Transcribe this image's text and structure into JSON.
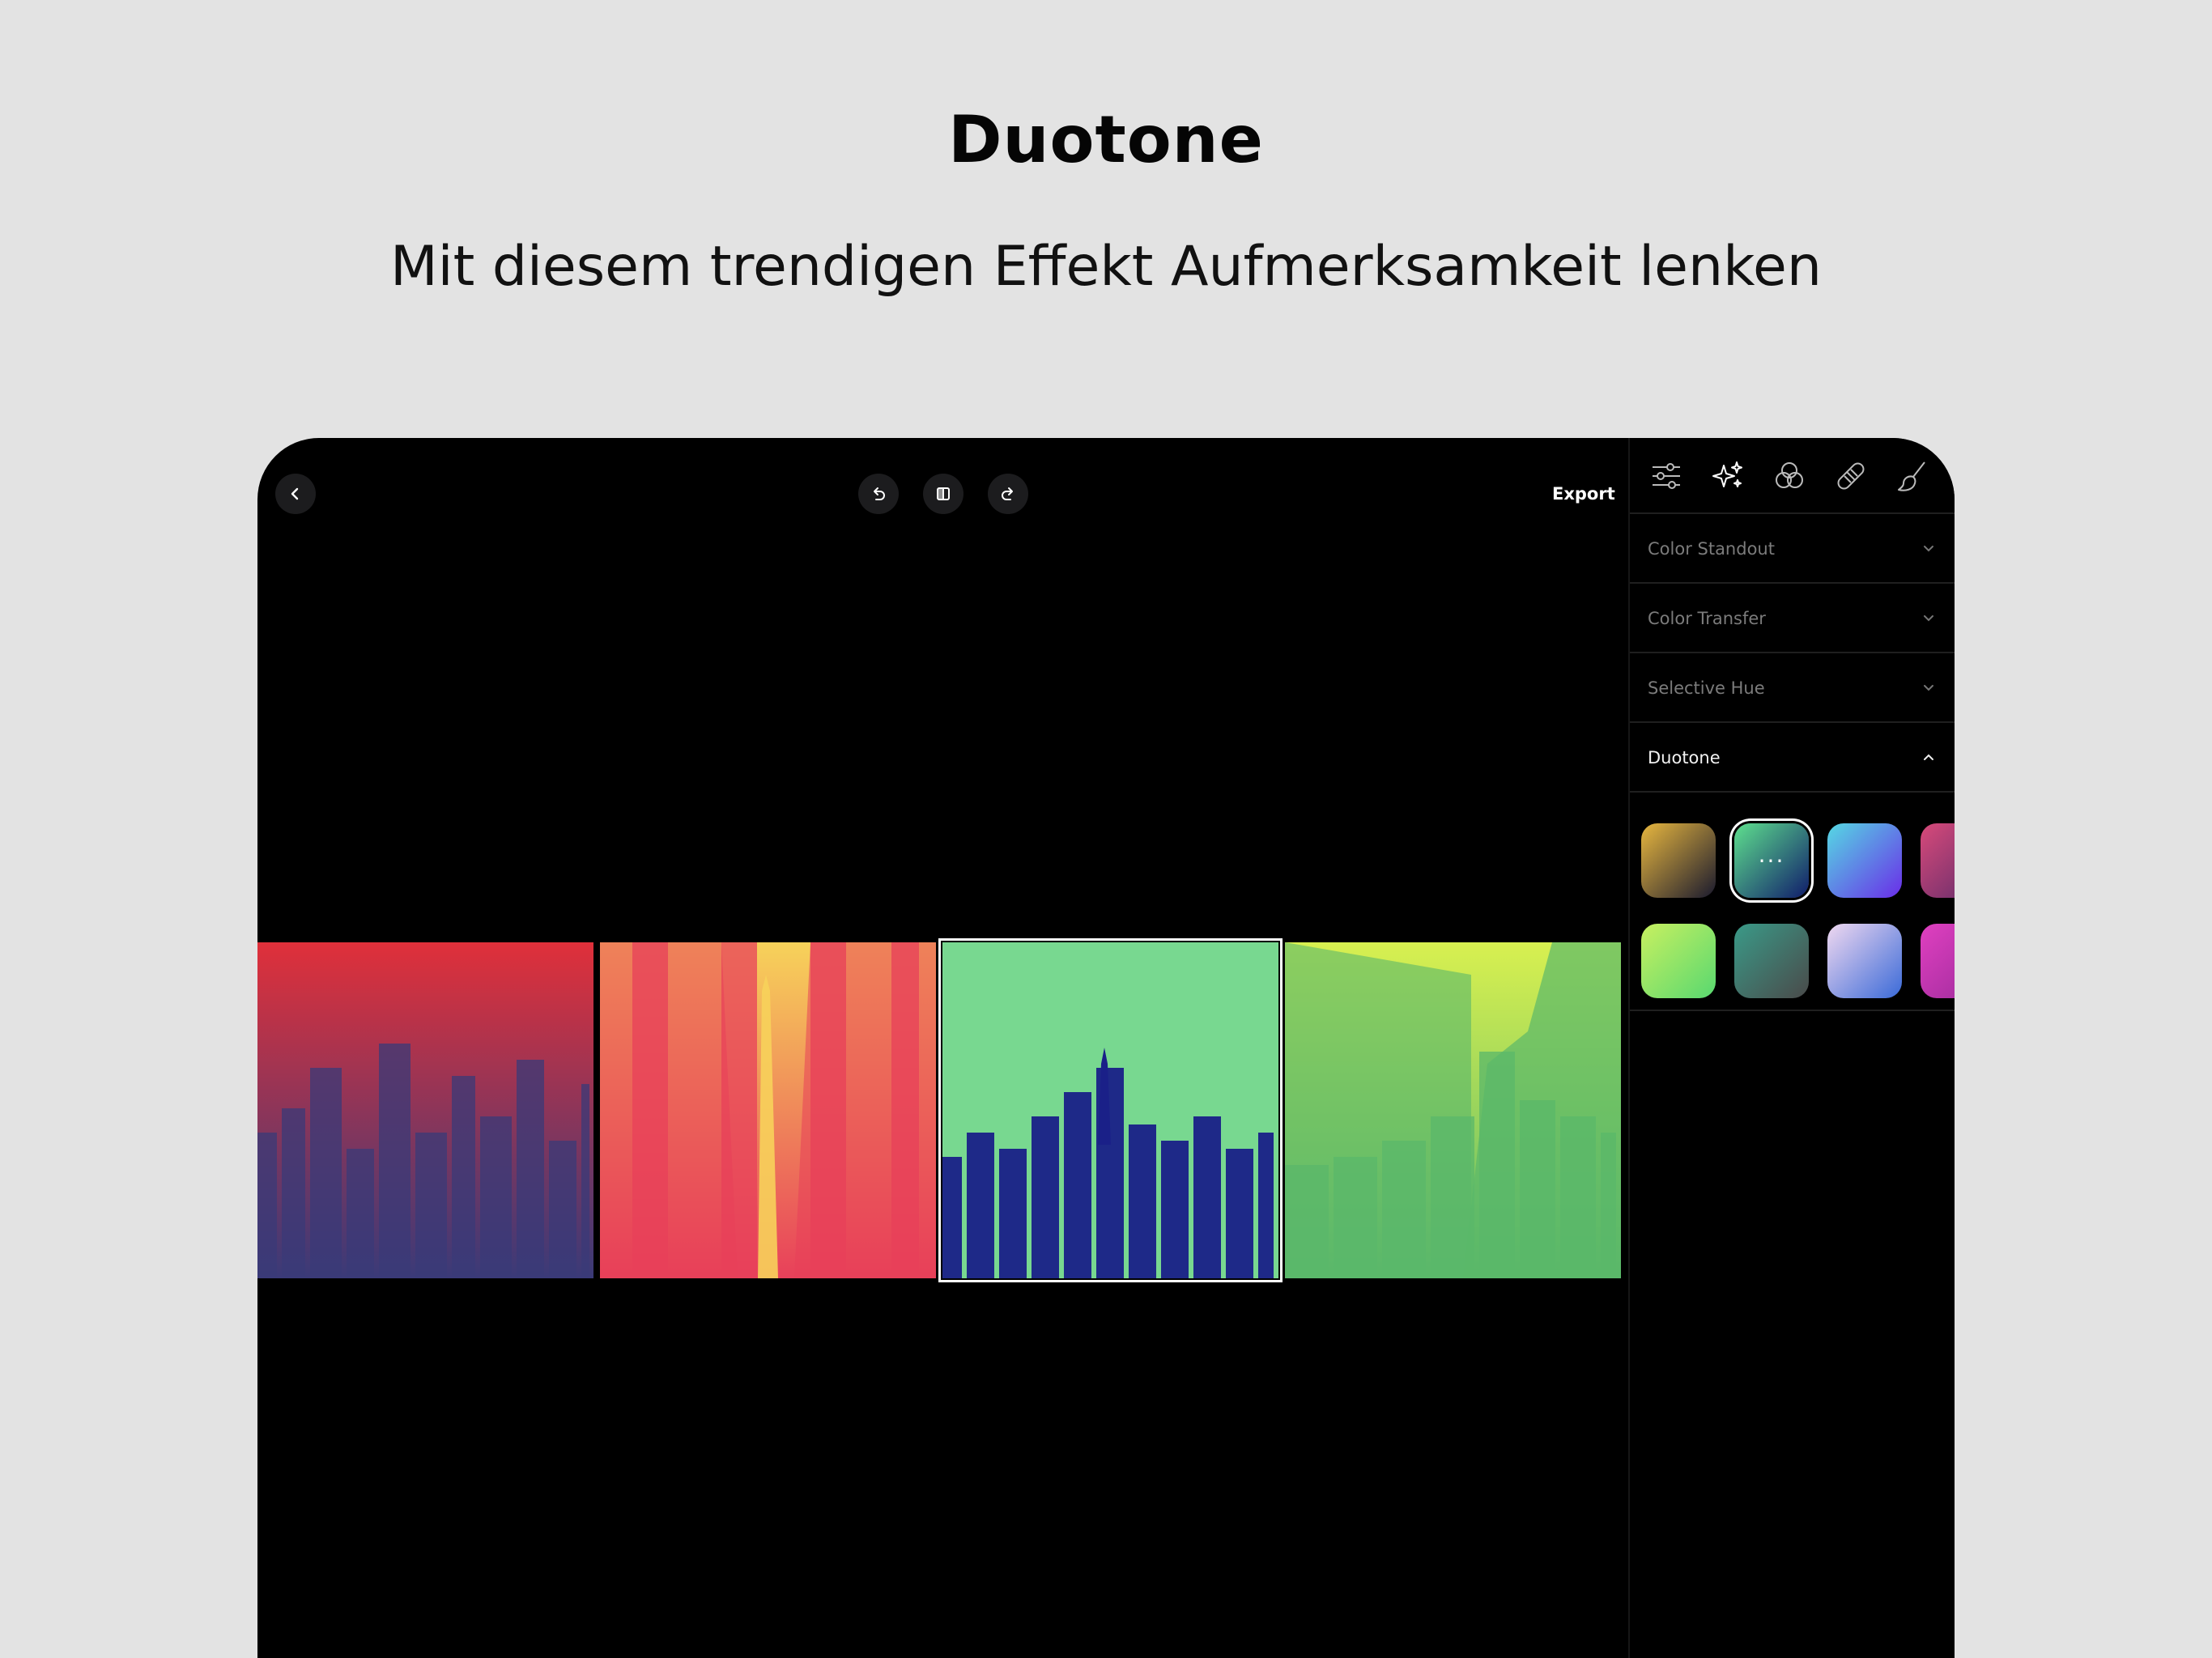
{
  "promo": {
    "title": "Duotone",
    "subtitle": "Mit diesem trendigen Effekt Aufmerksamkeit lenken"
  },
  "toolbar": {
    "back_icon": "chevron-left-icon",
    "undo_icon": "undo-icon",
    "compare_icon": "compare-icon",
    "redo_icon": "redo-icon",
    "export_label": "Export"
  },
  "tools": [
    {
      "name": "adjust-sliders-icon"
    },
    {
      "name": "sparkles-icon"
    },
    {
      "name": "color-mix-icon"
    },
    {
      "name": "bandage-icon"
    },
    {
      "name": "brush-icon"
    }
  ],
  "sections": [
    {
      "label": "Color Standout",
      "expanded": false
    },
    {
      "label": "Color Transfer",
      "expanded": false
    },
    {
      "label": "Selective Hue",
      "expanded": false
    },
    {
      "label": "Duotone",
      "expanded": true
    }
  ],
  "duotone_presets": [
    {
      "from": "#e8b73f",
      "to": "#1a1a2e",
      "selected": false
    },
    {
      "from": "#5ee08e",
      "to": "#101c6b",
      "selected": true,
      "more_label": "···"
    },
    {
      "from": "#55d9e3",
      "to": "#6a2de8",
      "selected": false
    },
    {
      "from": "#d84a7a",
      "to": "#5a2a6a",
      "selected": false
    },
    {
      "from": "#c8f060",
      "to": "#58d870",
      "selected": false
    },
    {
      "from": "#3a9a88",
      "to": "#4a4a4a",
      "selected": false
    },
    {
      "from": "#f0d8f0",
      "to": "#3a6ad8",
      "selected": false
    },
    {
      "from": "#e040c0",
      "to": "#9a2a9a",
      "selected": false
    }
  ],
  "photos": [
    {
      "name": "street-red-navy",
      "light": "#e0303a",
      "dark": "#3a3a78"
    },
    {
      "name": "tower-yellow-pink",
      "light": "#f7d25a",
      "dark": "#e8405a"
    },
    {
      "name": "skyline-green-navy",
      "light": "#78d890",
      "dark": "#1a2088",
      "selected": true
    },
    {
      "name": "buildings-lime-green",
      "light": "#d8f050",
      "dark": "#5ab86a"
    }
  ]
}
